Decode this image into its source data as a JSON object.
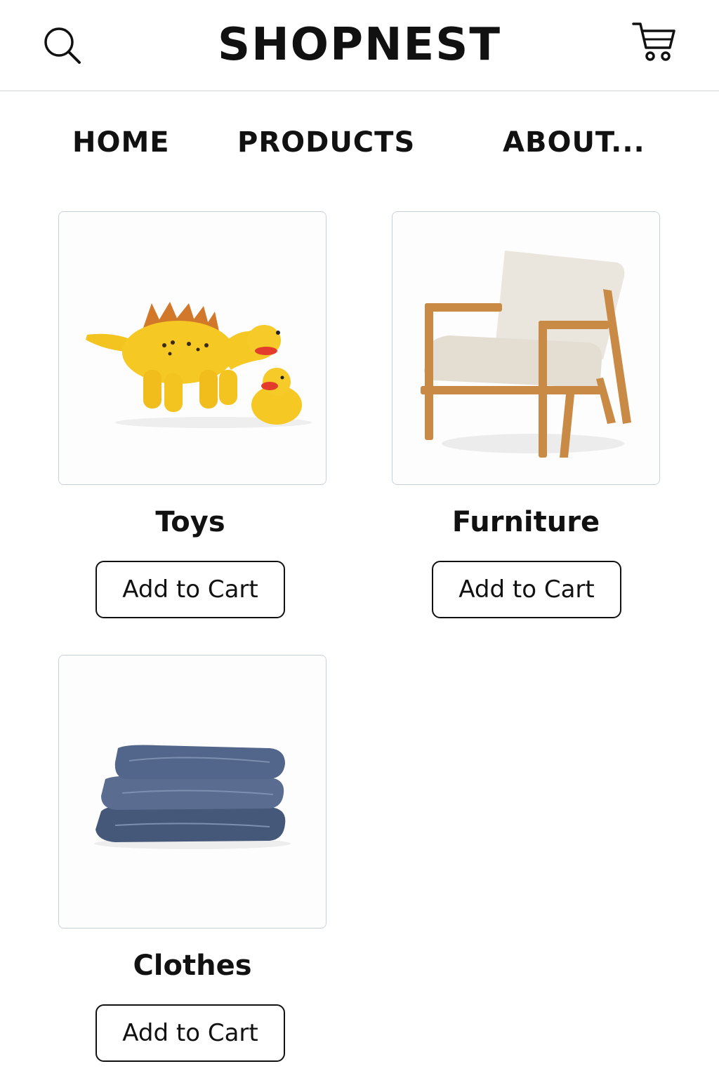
{
  "header": {
    "brand": "SHOPNEST",
    "search_icon": "search-icon",
    "cart_icon": "cart-icon"
  },
  "nav": {
    "items": [
      {
        "label": "HOME"
      },
      {
        "label": "PRODUCTS"
      },
      {
        "label": "ABOUT..."
      }
    ]
  },
  "products": [
    {
      "title": "Toys",
      "button": "Add to Cart",
      "image": "yellow-dinosaur-and-duck-toys"
    },
    {
      "title": "Furniture",
      "button": "Add to Cart",
      "image": "wooden-armchair-beige-cushions"
    },
    {
      "title": "Clothes",
      "button": "Add to Cart",
      "image": "folded-denim-jeans"
    }
  ],
  "colors": {
    "divider": "#c9d3dc",
    "card_border": "#c6d0da",
    "text": "#111111",
    "toy_yellow": "#f3c41f",
    "wood": "#c98a45",
    "cushion": "#ebe6dd",
    "denim": "#4f6285"
  }
}
